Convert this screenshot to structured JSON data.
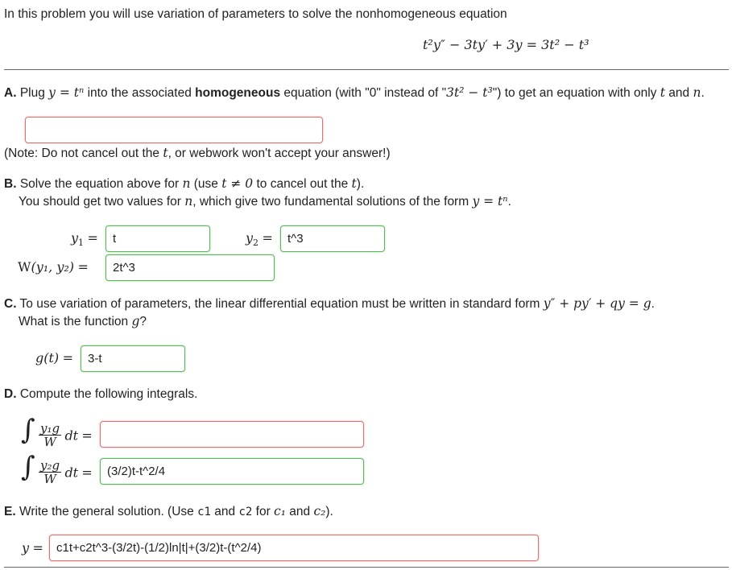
{
  "intro": "In this problem you will use variation of parameters to solve the nonhomogeneous equation",
  "equation": "t²y″ − 3ty′ + 3y = 3t² − t³",
  "partA": {
    "label": "A.",
    "text_before": "Plug",
    "sub": "y = tⁿ",
    "text_mid1": "into the associated",
    "bold": "homogeneous",
    "text_mid2": "equation (with \"0\" instead of \"",
    "rhs": "3t² − t³",
    "text_mid3": "\") to get an equation with only",
    "var_t": "t",
    "and": "and",
    "var_n": "n",
    "period": ".",
    "answer": "",
    "note": "(Note: Do not cancel out the",
    "note_t": "t",
    "note_end": ", or webwork won't accept your answer!)"
  },
  "partB": {
    "label": "B.",
    "line1_a": "Solve the equation above for",
    "line1_n": "n",
    "line1_b": "(use",
    "line1_cond": "t ≠ 0",
    "line1_c": "to cancel out the",
    "line1_t": "t",
    "line1_d": ").",
    "line2": "You should get two values for",
    "line2_n": "n",
    "line2_b": ", which give two fundamental solutions of the form",
    "line2_form": "y = tⁿ",
    "line2_end": ".",
    "y1_label": "y",
    "y1_sub": "1",
    "eq": "=",
    "y1": "t",
    "y2_label": "y",
    "y2_sub": "2",
    "y2": "t^3",
    "w_label": "W",
    "w_args": "(y₁, y₂)",
    "w": "2t^3"
  },
  "partC": {
    "label": "C.",
    "line1": "To use variation of parameters, the linear differential equation must be written in standard form",
    "std_form": "y″ + py′ + qy = g",
    "line1_end": ".",
    "line2": "What is the function",
    "line2_g": "g",
    "line2_end": "?",
    "g_label": "g(t)",
    "g": "3-t"
  },
  "partD": {
    "label": "D.",
    "text": "Compute the following integrals.",
    "int1_num": "y₁g",
    "int1_den": "W",
    "int2_num": "y₂g",
    "int2_den": "W",
    "dt": "dt",
    "int1": "",
    "int2": "(3/2)t-t^2/4"
  },
  "partE": {
    "label": "E.",
    "text_a": "Write the general solution. (Use",
    "code1": "c1",
    "and": "and",
    "code2": "c2",
    "for": "for",
    "c1": "c₁",
    "c2": "c₂",
    "end": ").",
    "y_label": "y",
    "y": "c1t+c2t^3-(3/2t)-(1/2)ln|t|+(3/2)t-(t^2/4)"
  }
}
